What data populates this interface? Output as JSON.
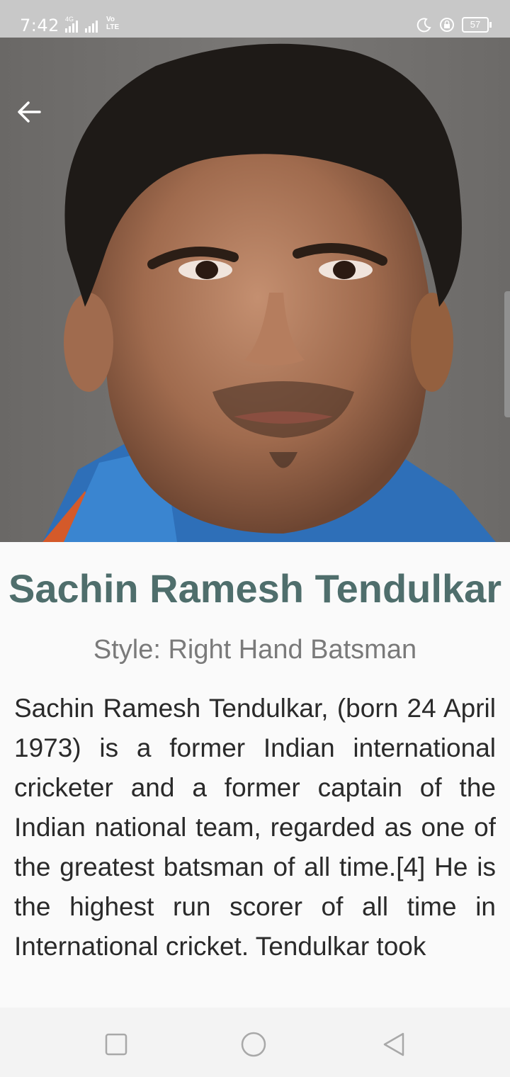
{
  "status_bar": {
    "time": "7:42",
    "network_label": "4G",
    "volte_top": "Vo",
    "volte_bottom": "LTE",
    "battery": "57",
    "icons": [
      "moon-icon",
      "lock-rotation-icon",
      "battery-icon"
    ]
  },
  "hero": {
    "image": "player-portrait",
    "back_icon": "arrow-left-icon"
  },
  "player": {
    "name": "Sachin Ramesh Tendulkar",
    "style": "Style: Right Hand Batsman",
    "bio": "Sachin Ramesh Tendulkar, (born 24 April 1973) is a former Indian international cricketer and a former captain of the Indian national team, regarded as one of the greatest batsman of all time.[4] He is the highest run scorer of all time in International cricket. Tendulkar took"
  },
  "nav_bar": {
    "icons": [
      "recents-square-icon",
      "home-circle-icon",
      "back-triangle-icon"
    ]
  },
  "colors": {
    "title": "#4f6e6c",
    "subtitle": "#7a7a7a",
    "body_text": "#2a2a2a",
    "status_bar_bg": "#c8c8c8",
    "background": "#fafafa"
  }
}
